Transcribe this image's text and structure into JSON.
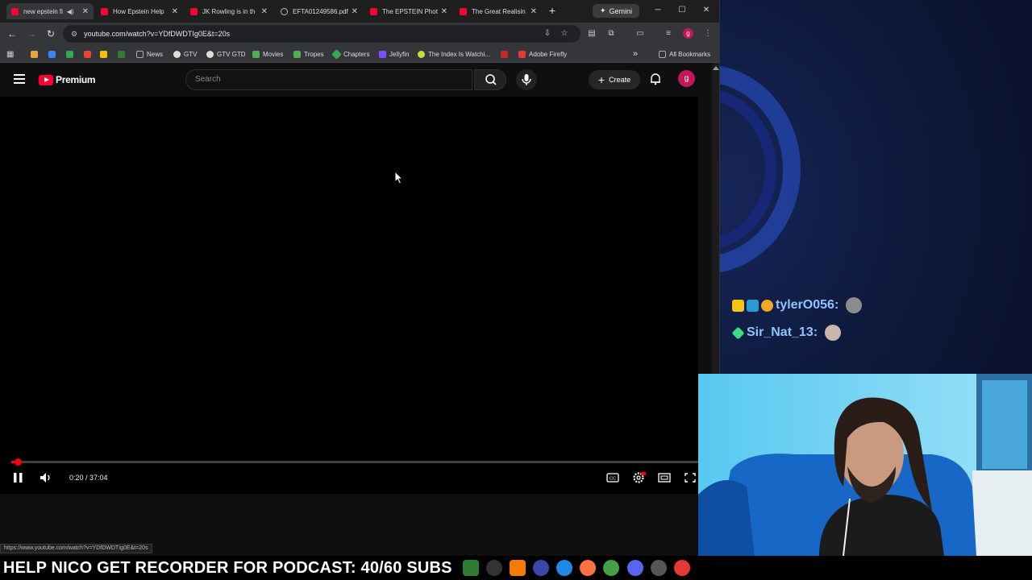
{
  "browser": {
    "tabs": [
      {
        "title": "new epstein fi",
        "active": true,
        "favicon": "youtube-icon"
      },
      {
        "title": "How Epstein Help",
        "favicon": "youtube-icon"
      },
      {
        "title": "JK Rowling is in th",
        "favicon": "youtube-icon"
      },
      {
        "title": "EFTA01249586.pdf",
        "favicon": "globe-icon"
      },
      {
        "title": "The EPSTEIN Phot",
        "favicon": "youtube-icon"
      },
      {
        "title": "The Great Realisin",
        "favicon": "youtube-icon"
      }
    ],
    "gemini_label": "Gemini",
    "url": "youtube.com/watch?v=YDfDWDTIg0E&t=20s",
    "profile_initial": "g",
    "bookmarks": [
      {
        "label": "News"
      },
      {
        "label": "GTV"
      },
      {
        "label": "GTV GTD"
      },
      {
        "label": "Movies"
      },
      {
        "label": "Tropes"
      },
      {
        "label": "Chapters"
      },
      {
        "label": "Jellyfin"
      },
      {
        "label": "The Index Is Watchi..."
      },
      {
        "label": "Adobe Firefly"
      }
    ],
    "all_bookmarks": "All Bookmarks",
    "status_url": "https://www.youtube.com/watch?v=YDfDWDTIg0E&t=20s"
  },
  "youtube": {
    "logo_text": "Premium",
    "search_placeholder": "Search",
    "create_label": "Create",
    "avatar_initial": "g",
    "player": {
      "time": "0:20 / 37:04",
      "progress_fraction": 0.009
    }
  },
  "overlay": {
    "chat": [
      {
        "user": "tylerO056:"
      },
      {
        "user": "Sir_Nat_13:"
      }
    ],
    "banner": "HELP NICO GET RECORDER FOR PODCAST: 40/60 SUBS"
  },
  "colors": {
    "youtube_red": "#ff0033",
    "chat_name": "#8fc4ff",
    "avatar": "#c2185b"
  }
}
